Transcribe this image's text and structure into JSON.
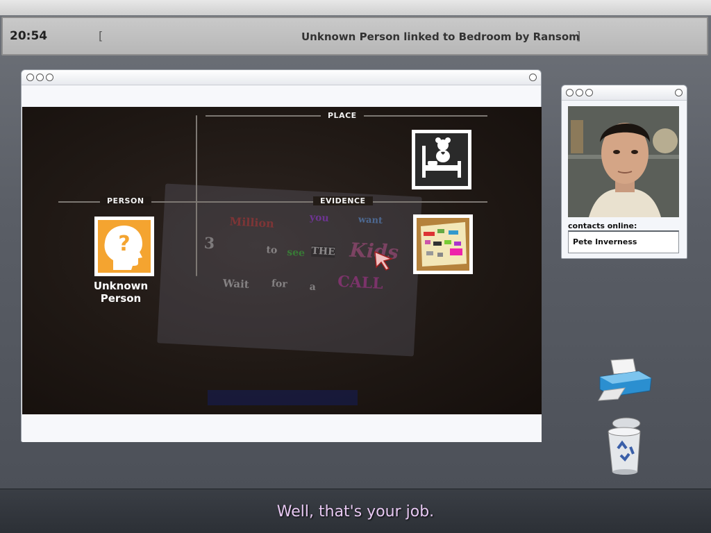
{
  "status_bar": {
    "clock": "20:54",
    "bracket_open": "[",
    "ticker": "Unknown Person linked to Bedroom by Ransom nc",
    "bracket_close": "]"
  },
  "board": {
    "labels": {
      "place": "PLACE",
      "person": "PERSON",
      "evidence": "EVIDENCE"
    },
    "person_caption": "Unknown Person",
    "note_words": [
      "Million",
      "you",
      "want",
      "to",
      "see",
      "THE",
      "Kids",
      "CALL",
      "Wait",
      "for",
      "a",
      "3"
    ]
  },
  "contacts": {
    "label": "contacts online:",
    "items": [
      "Pete Inverness"
    ]
  },
  "subtitle": "Well, that's your job.",
  "icons": {
    "place": "bedroom-teddy-icon",
    "person": "unknown-person-icon",
    "evidence": "ransom-note-icon",
    "printer": "printer-icon",
    "trash": "recycle-bin-icon",
    "cursor": "arrow-cursor-icon"
  },
  "colors": {
    "person_tile": "#f4a430",
    "place_tile": "#2a2a2a",
    "subtitle": "#e7c8f2"
  }
}
